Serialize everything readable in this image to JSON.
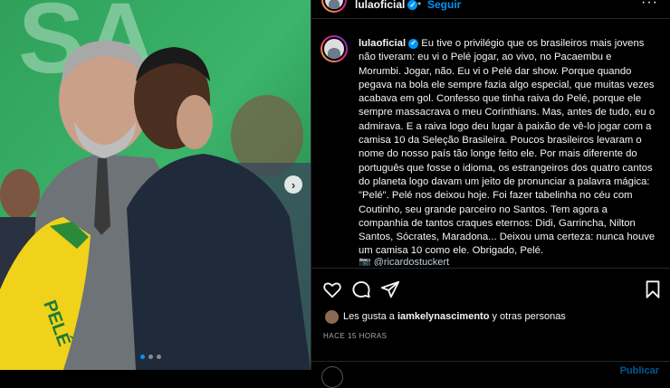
{
  "post": {
    "username": "lulaoficial",
    "separator": "•",
    "follow_label": "Seguir",
    "more_label": "···",
    "caption": "Eu tive o privilégio que os brasileiros mais jovens não tiveram: eu vi o Pelé jogar, ao vivo, no Pacaembu e Morumbi. Jogar, não. Eu vi o Pelé dar show. Porque quando pegava na bola ele sempre fazia algo especial, que muitas vezes acabava em gol. Confesso que tinha raiva do Pelé, porque ele sempre massacrava o meu Corinthians. Mas, antes de tudo, eu o admirava. E a raiva logo deu lugar à paixão de vê-lo jogar com a camisa 10 da Seleção Brasileira. Poucos brasileiros levaram o nome do nosso país tão longe feito ele. Por mais diferente do português que fosse o idioma, os estrangeiros dos quatro cantos do planeta logo davam um jeito de pronunciar a palavra mágica: \"Pelé\". Pelé nos deixou hoje. Foi fazer tabelinha no céu com Coutinho, seu grande parceiro no Santos. Tem agora a companhia de tantos craques eternos: Didi, Garrincha, Nilton Santos, Sócrates, Maradona... Deixou uma certeza: nunca houve um camisa 10 como ele. Obrigado, Pelé.",
    "mention": "📷 @ricardostuckert",
    "likes_prefix": "Les gusta a ",
    "likes_user": "iamkelynascimento",
    "likes_suffix": " y otras personas",
    "timestamp": "HACE 15 HORAS",
    "post_label": "Publicar"
  },
  "carousel": {
    "next_icon": "chevron-right-icon",
    "dots": 3,
    "active_dot": 0
  },
  "icons": [
    "heart-icon",
    "comment-icon",
    "share-icon",
    "bookmark-icon"
  ],
  "colors": {
    "accent": "#0095f6",
    "background": "#000000",
    "text": "#f5f5f5",
    "muted": "#a8a8a8"
  }
}
